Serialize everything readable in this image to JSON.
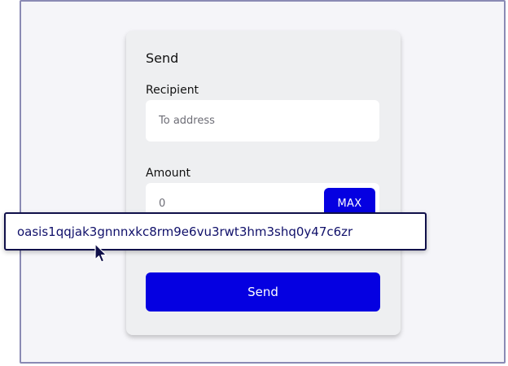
{
  "send_form": {
    "title": "Send",
    "recipient_label": "Recipient",
    "recipient_placeholder": "To address",
    "recipient_value": "",
    "amount_label": "Amount",
    "amount_placeholder": "0",
    "amount_value": "",
    "max_label": "MAX",
    "send_label": "Send"
  },
  "dragged_address": {
    "text": "oasis1qqjak3gnnnxkc8rm9e6vu3rwt3hm3shq0y47c6zr"
  },
  "cursor": {
    "icon": "mouse-pointer-icon"
  },
  "colors": {
    "accent": "#0500e1",
    "frame_border": "#8a8ab4",
    "tooltip_border": "#10104a"
  }
}
